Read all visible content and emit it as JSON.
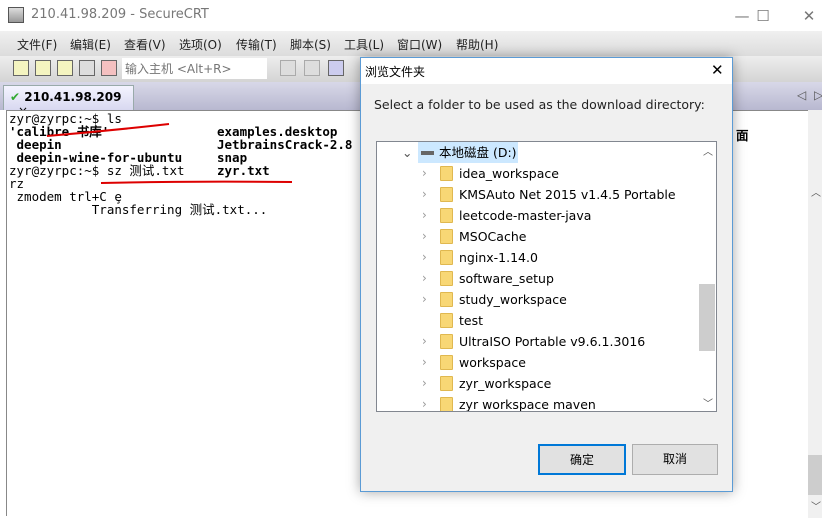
{
  "window": {
    "title": "210.41.98.209 - SecureCRT",
    "minimize": "—",
    "maximize": "☐",
    "close": "✕"
  },
  "menu": [
    "文件(F)",
    "编辑(E)",
    "查看(V)",
    "选项(O)",
    "传输(T)",
    "脚本(S)",
    "工具(L)",
    "窗口(W)",
    "帮助(H)"
  ],
  "toolbar": {
    "host_placeholder": "输入主机 <Alt+R>"
  },
  "tab": {
    "label": "210.41.98.209",
    "close": "×",
    "check": "✔"
  },
  "tab_nav": {
    "left": "◁",
    "right": "▷"
  },
  "terminal": {
    "lines": [
      {
        "c1": "zyr@zyrpc:~$ ls",
        "c2": ""
      },
      {
        "c1": "'calibre 书库'",
        "c2": "examples.desktop",
        "bold": true
      },
      {
        "c1": " deepin",
        "c2": "JetbrainsCrack-2.8",
        "bold": true
      },
      {
        "c1": " deepin-wine-for-ubuntu",
        "c2": "snap",
        "bold": true
      },
      {
        "c1": "zyr@zyrpc:~$ sz 测试.txt",
        "c2": "zyr.txt"
      },
      {
        "c1": "rz",
        "c2": ""
      },
      {
        "c1": " zmodem trl+C ȩ",
        "c2": ""
      },
      {
        "c1": "           Transferring 测试.txt...",
        "c2": ""
      }
    ],
    "partial_right": "面"
  },
  "dialog": {
    "title": "浏览文件夹",
    "close": "✕",
    "prompt": "Select a folder to be used as the download directory:",
    "root": "本地磁盘 (D:)",
    "folders": [
      {
        "name": "idea_workspace",
        "expandable": true
      },
      {
        "name": "KMSAuto Net 2015 v1.4.5 Portable",
        "expandable": true
      },
      {
        "name": "leetcode-master-java",
        "expandable": true
      },
      {
        "name": "MSOCache",
        "expandable": true
      },
      {
        "name": "nginx-1.14.0",
        "expandable": true
      },
      {
        "name": "software_setup",
        "expandable": true
      },
      {
        "name": "study_workspace",
        "expandable": true
      },
      {
        "name": "test",
        "expandable": false
      },
      {
        "name": "UltraISO Portable v9.6.1.3016",
        "expandable": true
      },
      {
        "name": "workspace",
        "expandable": true
      },
      {
        "name": "zyr_workspace",
        "expandable": true
      },
      {
        "name": "zyr workspace maven",
        "expandable": true
      }
    ],
    "ok": "确定",
    "cancel": "取消",
    "accent": "#0078d7"
  }
}
